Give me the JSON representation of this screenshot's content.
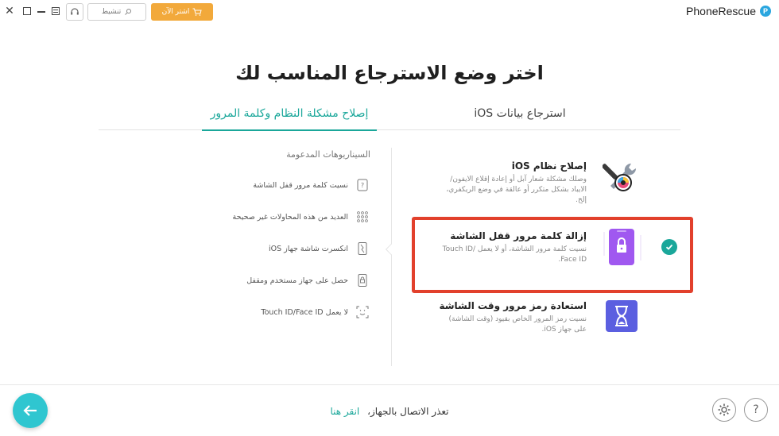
{
  "window": {
    "brand": "PhoneRescue",
    "activate_label": "تنشيط",
    "buy_label": "اشتر الآن"
  },
  "header": {
    "title": "اختر وضع الاسترجاع المناسب لك",
    "tabs": [
      {
        "label": "استرجاع بيانات iOS",
        "active": false
      },
      {
        "label": "إصلاح مشكلة النظام وكلمة المرور",
        "active": true
      }
    ]
  },
  "scenarios": {
    "title": "السيناريوهات المدعومة",
    "items": [
      {
        "label": "نسيت كلمة مرور قفل الشاشة",
        "icon": "password-icon"
      },
      {
        "label": "العديد من هذه المحاولات غير صحيحة",
        "icon": "keypad-icon"
      },
      {
        "label": "انكسرت شاشة جهاز iOS",
        "icon": "broken-phone-icon"
      },
      {
        "label": "حصل على جهاز مستخدم ومقفل",
        "icon": "lock-icon"
      },
      {
        "label": "لا يعمل Touch ID/Face ID",
        "icon": "face-id-icon"
      }
    ]
  },
  "options": [
    {
      "title": "إصلاح نظام iOS",
      "desc": "وصلك مشكلة شعار آبل أو إعادة إقلاع الايفون/الايباد بشكل متكرر أو عالقة في وضع الريكفري، إلخ.",
      "icon": "tools-icon",
      "selected": false
    },
    {
      "title": "إزالة كلمة مرور قفل الشاشة",
      "desc": "نسيت كلمة مرور الشاشة، أو لا يعمل Touch ID/ Face ID.",
      "icon": "screen-lock-icon",
      "selected": true
    },
    {
      "title": "استعادة رمز مرور وقت الشاشة",
      "desc": "نسيت رمز المرور الخاص بقيود (وقت الشاشة) على جهاز iOS.",
      "icon": "hourglass-icon",
      "selected": false
    }
  ],
  "footer": {
    "message": "تعذر الاتصال بالجهاز،",
    "link": "انقر هنا"
  },
  "colors": {
    "accent": "#1aa79a",
    "highlight": "#e2402c",
    "buy": "#f2a93b",
    "back": "#2fc6d0"
  }
}
